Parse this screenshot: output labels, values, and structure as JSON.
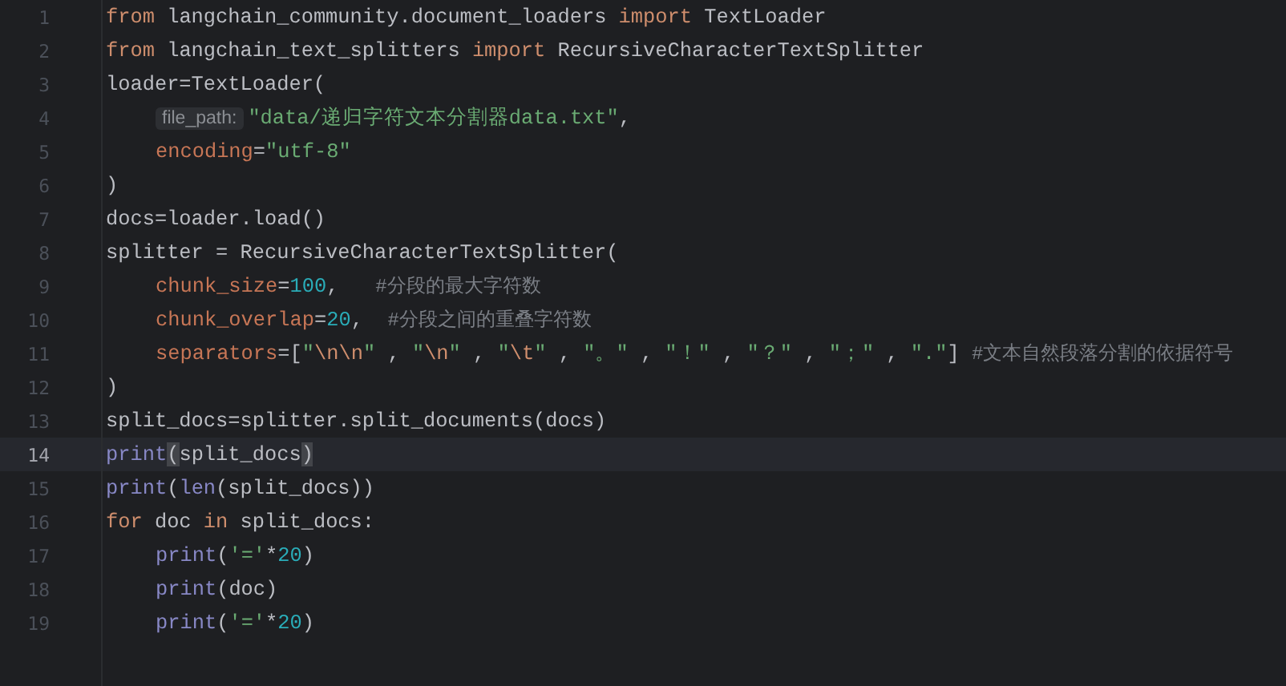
{
  "editor": {
    "lines": [
      {
        "number": "1",
        "current": false,
        "indented": false,
        "tokens": [
          {
            "kind": "keyword",
            "text": "from"
          },
          {
            "kind": "plain",
            "text": " langchain_community.document_loaders "
          },
          {
            "kind": "keyword",
            "text": "import"
          },
          {
            "kind": "plain",
            "text": " TextLoader"
          }
        ]
      },
      {
        "number": "2",
        "current": false,
        "indented": false,
        "tokens": [
          {
            "kind": "keyword",
            "text": "from"
          },
          {
            "kind": "plain",
            "text": " langchain_text_splitters "
          },
          {
            "kind": "keyword",
            "text": "import"
          },
          {
            "kind": "plain",
            "text": " RecursiveCharacterTextSplitter"
          }
        ]
      },
      {
        "number": "3",
        "current": false,
        "indented": false,
        "tokens": [
          {
            "kind": "plain",
            "text": "loader=TextLoader("
          }
        ]
      },
      {
        "number": "4",
        "current": false,
        "indented": true,
        "tokens": [
          {
            "kind": "hint",
            "text": "file_path:"
          },
          {
            "kind": "string",
            "text": "\"data/递归字符文本分割器data.txt\""
          },
          {
            "kind": "plain",
            "text": ","
          }
        ]
      },
      {
        "number": "5",
        "current": false,
        "indented": true,
        "tokens": [
          {
            "kind": "argument",
            "text": "encoding"
          },
          {
            "kind": "plain",
            "text": "="
          },
          {
            "kind": "string",
            "text": "\"utf-8\""
          }
        ]
      },
      {
        "number": "6",
        "current": false,
        "indented": false,
        "tokens": [
          {
            "kind": "plain",
            "text": ")"
          }
        ]
      },
      {
        "number": "7",
        "current": false,
        "indented": false,
        "tokens": [
          {
            "kind": "plain",
            "text": "docs=loader.load()"
          }
        ]
      },
      {
        "number": "8",
        "current": false,
        "indented": false,
        "tokens": [
          {
            "kind": "plain",
            "text": "splitter = RecursiveCharacterTextSplitter("
          }
        ]
      },
      {
        "number": "9",
        "current": false,
        "indented": true,
        "tokens": [
          {
            "kind": "argument",
            "text": "chunk_size"
          },
          {
            "kind": "plain",
            "text": "="
          },
          {
            "kind": "number",
            "text": "100"
          },
          {
            "kind": "plain",
            "text": ",   "
          },
          {
            "kind": "comment",
            "text": "#分段的最大字符数"
          }
        ]
      },
      {
        "number": "10",
        "current": false,
        "indented": true,
        "tokens": [
          {
            "kind": "argument",
            "text": "chunk_overlap"
          },
          {
            "kind": "plain",
            "text": "="
          },
          {
            "kind": "number",
            "text": "20"
          },
          {
            "kind": "plain",
            "text": ",  "
          },
          {
            "kind": "comment",
            "text": "#分段之间的重叠字符数"
          }
        ]
      },
      {
        "number": "11",
        "current": false,
        "indented": true,
        "tokens": [
          {
            "kind": "argument",
            "text": "separators"
          },
          {
            "kind": "plain",
            "text": "=["
          },
          {
            "kind": "string",
            "text": "\""
          },
          {
            "kind": "escape",
            "text": "\\n\\n"
          },
          {
            "kind": "string",
            "text": "\""
          },
          {
            "kind": "plain",
            "text": " , "
          },
          {
            "kind": "string",
            "text": "\""
          },
          {
            "kind": "escape",
            "text": "\\n"
          },
          {
            "kind": "string",
            "text": "\""
          },
          {
            "kind": "plain",
            "text": " , "
          },
          {
            "kind": "string",
            "text": "\""
          },
          {
            "kind": "escape",
            "text": "\\t"
          },
          {
            "kind": "string",
            "text": "\""
          },
          {
            "kind": "plain",
            "text": " , "
          },
          {
            "kind": "string",
            "text": "\"。\""
          },
          {
            "kind": "plain",
            "text": " , "
          },
          {
            "kind": "string",
            "text": "\"！\""
          },
          {
            "kind": "plain",
            "text": " , "
          },
          {
            "kind": "string",
            "text": "\"？\""
          },
          {
            "kind": "plain",
            "text": " , "
          },
          {
            "kind": "string",
            "text": "\"；\""
          },
          {
            "kind": "plain",
            "text": " , "
          },
          {
            "kind": "string",
            "text": "\".\""
          },
          {
            "kind": "plain",
            "text": "] "
          },
          {
            "kind": "comment",
            "text": "#文本自然段落分割的依据符号"
          }
        ]
      },
      {
        "number": "12",
        "current": false,
        "indented": false,
        "tokens": [
          {
            "kind": "plain",
            "text": ")"
          }
        ]
      },
      {
        "number": "13",
        "current": false,
        "indented": false,
        "tokens": [
          {
            "kind": "plain",
            "text": "split_docs=splitter.split_documents(docs)"
          }
        ]
      },
      {
        "number": "14",
        "current": true,
        "indented": false,
        "tokens": [
          {
            "kind": "builtin",
            "text": "print"
          },
          {
            "kind": "match",
            "text": "("
          },
          {
            "kind": "plain",
            "text": "split_docs"
          },
          {
            "kind": "match",
            "text": ")"
          }
        ]
      },
      {
        "number": "15",
        "current": false,
        "indented": false,
        "tokens": [
          {
            "kind": "builtin",
            "text": "print"
          },
          {
            "kind": "plain",
            "text": "("
          },
          {
            "kind": "builtin",
            "text": "len"
          },
          {
            "kind": "plain",
            "text": "(split_docs))"
          }
        ]
      },
      {
        "number": "16",
        "current": false,
        "indented": false,
        "tokens": [
          {
            "kind": "keyword",
            "text": "for"
          },
          {
            "kind": "plain",
            "text": " doc "
          },
          {
            "kind": "keyword",
            "text": "in"
          },
          {
            "kind": "plain",
            "text": " split_docs:"
          }
        ]
      },
      {
        "number": "17",
        "current": false,
        "indented": true,
        "tokens": [
          {
            "kind": "builtin",
            "text": "print"
          },
          {
            "kind": "plain",
            "text": "("
          },
          {
            "kind": "string",
            "text": "'='"
          },
          {
            "kind": "plain",
            "text": "*"
          },
          {
            "kind": "number",
            "text": "20"
          },
          {
            "kind": "plain",
            "text": ")"
          }
        ]
      },
      {
        "number": "18",
        "current": false,
        "indented": true,
        "tokens": [
          {
            "kind": "builtin",
            "text": "print"
          },
          {
            "kind": "plain",
            "text": "(doc)"
          }
        ]
      },
      {
        "number": "19",
        "current": false,
        "indented": true,
        "tokens": [
          {
            "kind": "builtin",
            "text": "print"
          },
          {
            "kind": "plain",
            "text": "("
          },
          {
            "kind": "string",
            "text": "'='"
          },
          {
            "kind": "plain",
            "text": "*"
          },
          {
            "kind": "number",
            "text": "20"
          },
          {
            "kind": "plain",
            "text": ")"
          }
        ]
      }
    ]
  }
}
